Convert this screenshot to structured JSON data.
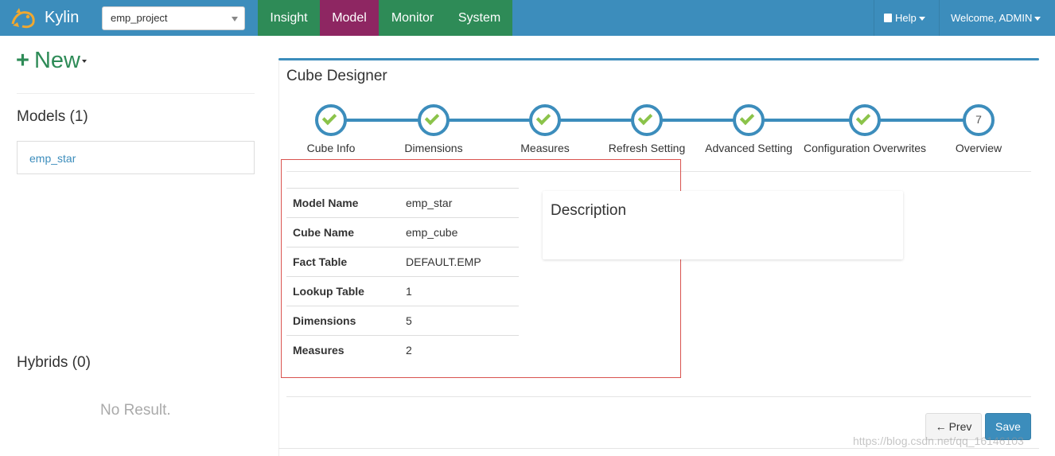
{
  "app": {
    "brand": "Kylin",
    "project": "emp_project"
  },
  "nav": {
    "tabs": [
      {
        "label": "Insight"
      },
      {
        "label": "Model"
      },
      {
        "label": "Monitor"
      },
      {
        "label": "System"
      }
    ],
    "active_tab": "Model",
    "help": "Help",
    "welcome": "Welcome, ADMIN"
  },
  "sidebar": {
    "new_label": "New",
    "models_title": "Models (1)",
    "models": [
      "emp_star"
    ],
    "hybrids_title": "Hybrids (0)",
    "no_result": "No Result."
  },
  "designer": {
    "title": "Cube Designer",
    "steps": [
      {
        "label": "Cube Info",
        "done": true
      },
      {
        "label": "Dimensions",
        "done": true
      },
      {
        "label": "Measures",
        "done": true
      },
      {
        "label": "Refresh Setting",
        "done": true
      },
      {
        "label": "Advanced Setting",
        "done": true
      },
      {
        "label": "Configuration Overwrites",
        "done": true
      },
      {
        "label": "Overview",
        "done": false,
        "number": "7"
      }
    ],
    "info": [
      {
        "key": "Model Name",
        "value": "emp_star"
      },
      {
        "key": "Cube Name",
        "value": "emp_cube"
      },
      {
        "key": "Fact Table",
        "value": "DEFAULT.EMP"
      },
      {
        "key": "Lookup Table",
        "value": "1"
      },
      {
        "key": "Dimensions",
        "value": "5"
      },
      {
        "key": "Measures",
        "value": "2"
      }
    ],
    "description_title": "Description",
    "prev_label": "Prev",
    "save_label": "Save"
  },
  "colors": {
    "topbar": "#3c8dbc",
    "nav_green": "#2e8b57",
    "nav_active": "#8e2662",
    "check_green": "#8bc34a",
    "highlight_border": "#d9534f"
  },
  "watermark": "https://blog.csdn.net/qq_16146103"
}
